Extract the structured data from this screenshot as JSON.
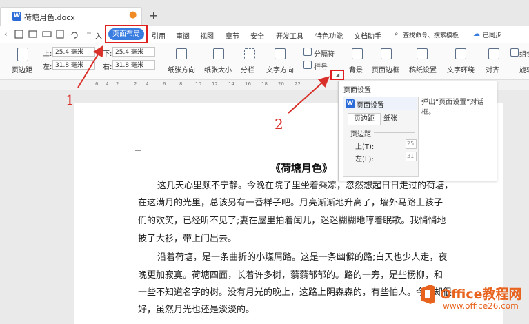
{
  "window": {
    "doc_tab_title": "荷塘月色.docx",
    "new_tab": "+"
  },
  "menu": {
    "partial_left": "入",
    "active_tab": "页面布局",
    "tabs": [
      "引用",
      "审阅",
      "视图",
      "章节",
      "安全",
      "开发工具",
      "特色功能",
      "文档助手"
    ],
    "search_placeholder": "查找命令、搜索模板",
    "sync_status": "已同步"
  },
  "ribbon": {
    "margins_button": "页边距",
    "margin_top_label": "上:",
    "margin_top": "25.4 毫米",
    "margin_bottom_label": "下:",
    "margin_bottom": "25.4 毫米",
    "margin_left_label": "左:",
    "margin_left": "31.8 毫米",
    "margin_right_label": "右:",
    "margin_right": "31.8 毫米",
    "orientation": "纸张方向",
    "size": "纸张大小",
    "columns": "分栏",
    "text_direction": "文字方向",
    "break": "分隔符",
    "line_numbers": "行号",
    "background": "背景",
    "page_border": "页面边框",
    "manuscript": "稿纸设置",
    "text_wrap": "文字环绕",
    "align": "对齐",
    "group": "组合",
    "rotate": "旋转"
  },
  "ruler_numbers": [
    "6",
    "4",
    "2",
    "2",
    "4",
    "6",
    "8",
    "10",
    "12",
    "14",
    "16",
    "18",
    "20",
    "22"
  ],
  "tooltip": {
    "title": "页面设置",
    "description": "弹出“页面设置”对话框。",
    "preview": {
      "title": "页面设置",
      "tab_margins": "页边距",
      "tab_paper": "纸张",
      "section_margins": "页边距",
      "top": "上(T):",
      "left": "左(L):",
      "top_value": "25",
      "left_value": "31"
    }
  },
  "document": {
    "heading": "《荷塘月色》",
    "lines": [
      "这几天心里颇不宁静。今晚在院子里坐着乘凉，忽然想起日日走过的荷塘，",
      "在这满月的光里，总该另有一番样子吧。月亮渐渐地升高了，墙外马路上孩子",
      "们的欢笑，已经听不见了;妻在屋里拍着闰儿，迷迷糊糊地哼着眠歌。我悄悄地",
      "披了大衫，带上门出去。",
      "沿着荷塘，是一条曲折的小煤屑路。这是一条幽僻的路;白天也少人走，夜",
      "晚更加寂寞。荷塘四面，长着许多树，蓊蓊郁郁的。路的一旁，是些杨柳，和",
      "一些不知道名字的树。没有月光的晚上，这路上阴森森的，有些怕人。今晚却很",
      "好，虽然月光也还是淡淡的。"
    ]
  },
  "annotations": {
    "step1": "1",
    "step2": "2"
  },
  "watermark": {
    "brand": "Office教程网",
    "url": "www.office26.com"
  },
  "colors": {
    "accent": "#3a7de1",
    "highlight": "#e02020",
    "arrow": "#d9302a",
    "watermark_orange": "#e8641e"
  }
}
